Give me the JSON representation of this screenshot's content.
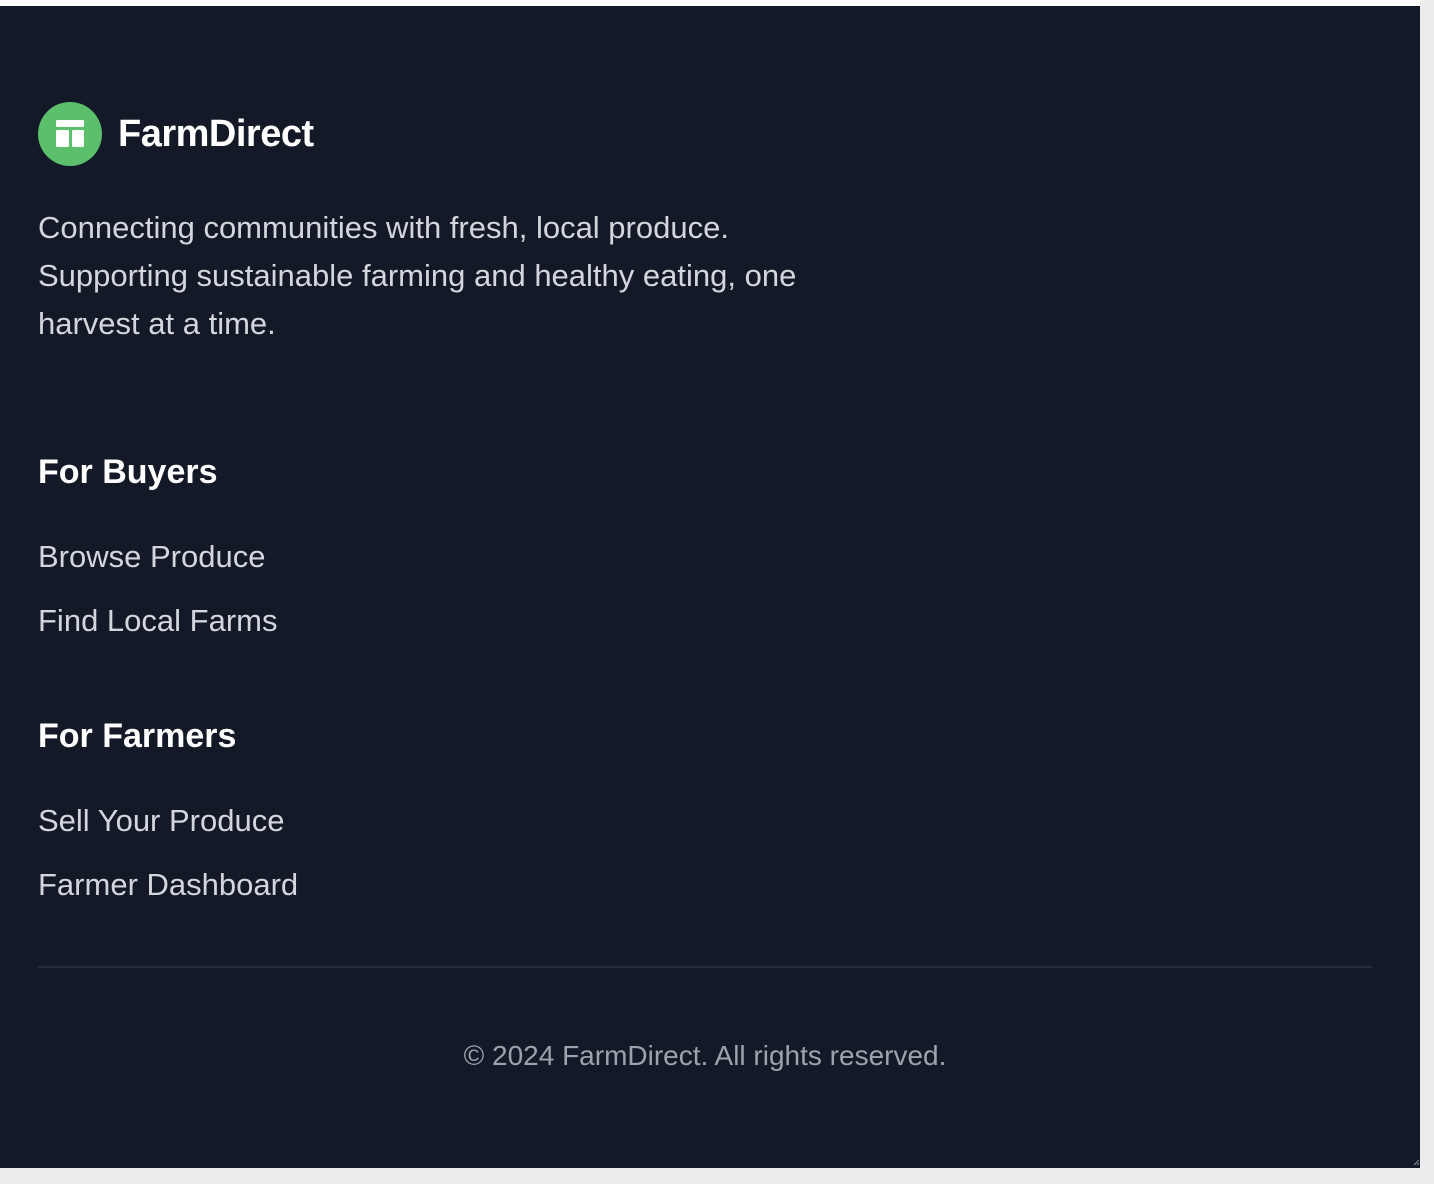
{
  "brand": {
    "name": "FarmDirect",
    "logo_icon": "storefront-icon",
    "logo_color": "#5bbf6c"
  },
  "tagline": "Connecting communities with fresh, local produce. Supporting sustainable farming and healthy eating, one harvest at a time.",
  "sections": [
    {
      "title": "For Buyers",
      "links": [
        "Browse Produce",
        "Find Local Farms"
      ]
    },
    {
      "title": "For Farmers",
      "links": [
        "Sell Your Produce",
        "Farmer Dashboard"
      ]
    }
  ],
  "copyright": "© 2024 FarmDirect. All rights reserved.",
  "colors": {
    "footer_background": "#131927",
    "heading_text": "#ffffff",
    "body_text": "#d3d6dc",
    "muted_text": "#9ca3af",
    "divider": "#262c39"
  }
}
